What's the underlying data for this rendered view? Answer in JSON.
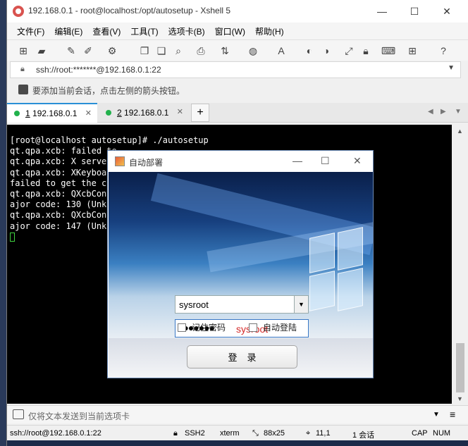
{
  "window": {
    "title": "192.168.0.1 - root@localhost:/opt/autosetup - Xshell 5",
    "controls": {
      "minimize": "—",
      "maximize": "☐",
      "close": "✕"
    }
  },
  "menu": [
    "文件(F)",
    "编辑(E)",
    "查看(V)",
    "工具(T)",
    "选项卡(B)",
    "窗口(W)",
    "帮助(H)"
  ],
  "address": {
    "value": "ssh://root:*******@192.168.0.1:22"
  },
  "hint": {
    "text": "要添加当前会话，点击左侧的箭头按钮。"
  },
  "tabs": [
    {
      "index": "1",
      "label": "192.168.0.1",
      "active": true
    },
    {
      "index": "2",
      "label": "192.168.0.1",
      "active": false
    }
  ],
  "tab_add": "+",
  "terminal": {
    "lines": [
      "[root@localhost autosetup]# ./autosetup",
      "qt.qpa.xcb: failed to",
      "qt.qpa.xcb: X server",
      "qt.qpa.xcb: XKeyboard",
      "failed to get the cur",
      "qt.qpa.xcb: QXcbConne                         rce id: 88, m",
      "ajor code: 130 (Unkno",
      "qt.qpa.xcb: QXcbConne                         rce id: 88, m",
      "ajor code: 147 (Unkno"
    ]
  },
  "send_bar": {
    "placeholder": "仅将文本发送到当前选项卡"
  },
  "status": {
    "connection": "ssh://root@192.168.0.1:22",
    "protocol": "SSH2",
    "terminal": "xterm",
    "size": "88x25",
    "position": "11,1",
    "sessions": "1 会话",
    "caps": "CAP",
    "num": "NUM"
  },
  "dialog": {
    "title": "自动部署",
    "username": "sysroot",
    "password_mask": "●●●●●●●",
    "password_annotation": "sysroot",
    "remember_password": "记住密码",
    "auto_login": "自动登陆",
    "login_button": "登录"
  },
  "colors": {
    "tab_active_accent": "#2a8fd6",
    "connected_dot": "#22b14c",
    "annotation_red": "#d42a2a"
  }
}
